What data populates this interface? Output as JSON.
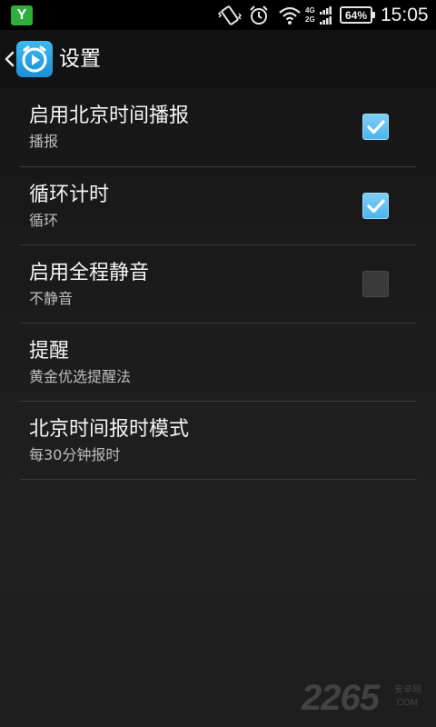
{
  "status_bar": {
    "notification_app_letter": "Y",
    "network_top": "4G",
    "network_bottom": "2G",
    "battery": "64%",
    "time": "15:05",
    "icons": [
      "vibrate-icon",
      "alarm-clock-icon",
      "wifi-icon",
      "signal-icon",
      "battery-icon"
    ]
  },
  "action_bar": {
    "title": "设置",
    "icons": [
      "back-chevron-icon",
      "app-play-icon"
    ]
  },
  "settings": [
    {
      "title": "启用北京时间播报",
      "summary": "播报",
      "checkbox": true
    },
    {
      "title": "循环计时",
      "summary": "循环",
      "checkbox": true
    },
    {
      "title": "启用全程静音",
      "summary": "不静音",
      "checkbox": false
    },
    {
      "title": "提醒",
      "summary": "黄金优选提醒法",
      "checkbox": null
    },
    {
      "title": "北京时间报时模式",
      "summary": "每30分钟报时",
      "checkbox": null
    }
  ],
  "watermark": {
    "number": "2265",
    "side_top": "安卓网",
    "side_bottom": ".COM"
  },
  "colors": {
    "checkbox_checked": "#4cb5ec",
    "app_icon": "#1c8fd6",
    "notification_icon": "#2fae3c"
  }
}
